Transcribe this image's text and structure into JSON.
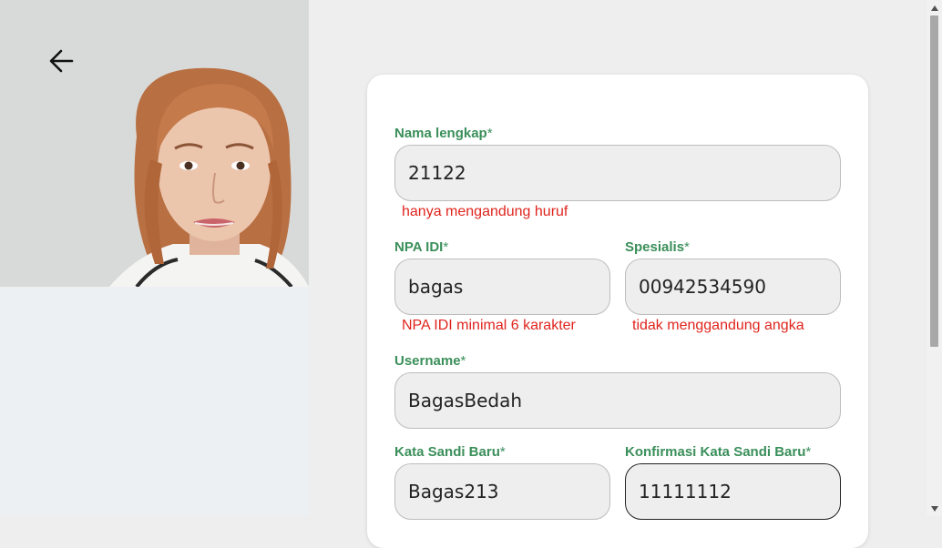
{
  "form": {
    "nama": {
      "label": "Nama lengkap",
      "required": "*",
      "value": "21122",
      "error": "hanya mengandung huruf"
    },
    "npa": {
      "label": "NPA IDI",
      "required": "*",
      "value": "bagas",
      "error": "NPA IDI minimal 6 karakter"
    },
    "spesialis": {
      "label": "Spesialis",
      "required": "*",
      "value": "00942534590",
      "error": "tidak menggandung angka"
    },
    "username": {
      "label": "Username",
      "required": "*",
      "value": "BagasBedah"
    },
    "password": {
      "label": "Kata Sandi Baru",
      "required": "*",
      "value": "Bagas213"
    },
    "confirm": {
      "label": "Konfirmasi Kata Sandi Baru",
      "required": "*",
      "value": "11111112"
    }
  },
  "colors": {
    "label": "#3a8f5a",
    "error": "#e0241d",
    "input_bg": "#eeeeee",
    "page_bg": "#eeeeee",
    "card_bg": "#ffffff"
  },
  "icons": {
    "back": "arrow-left-icon",
    "scroll_up": "triangle-up-icon",
    "scroll_down": "triangle-down-icon"
  }
}
